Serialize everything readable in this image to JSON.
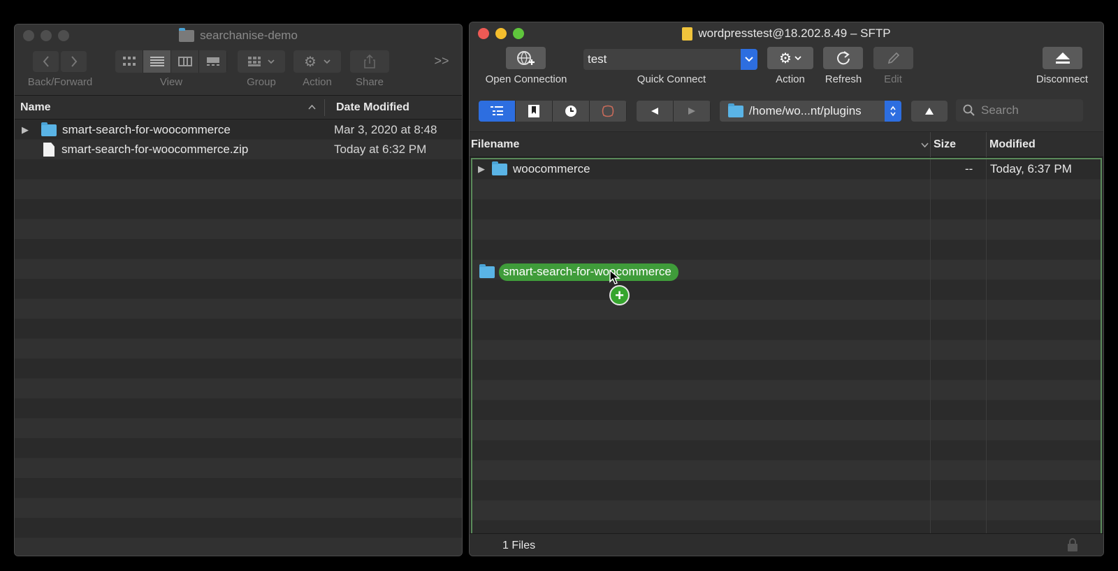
{
  "finder": {
    "title": "searchanise-demo",
    "toolbar": {
      "back_forward_label": "Back/Forward",
      "view_label": "View",
      "group_label": "Group",
      "action_label": "Action",
      "share_label": "Share",
      "more_label": ">>"
    },
    "columns": {
      "name": "Name",
      "date_modified": "Date Modified"
    },
    "rows": [
      {
        "name": "smart-search-for-woocommerce",
        "date": "Mar 3, 2020 at 8:48",
        "kind": "folder"
      },
      {
        "name": "smart-search-for-woocommerce.zip",
        "date": "Today at 6:32 PM",
        "kind": "file"
      }
    ]
  },
  "sftp": {
    "title": "wordpresstest@18.202.8.49 – SFTP",
    "toolbar": {
      "open_connection_label": "Open Connection",
      "quick_connect_value": "test",
      "quick_connect_label": "Quick Connect",
      "action_label": "Action",
      "refresh_label": "Refresh",
      "edit_label": "Edit",
      "disconnect_label": "Disconnect"
    },
    "path": "/home/wo...nt/plugins",
    "search_placeholder": "Search",
    "columns": {
      "filename": "Filename",
      "size": "Size",
      "modified": "Modified"
    },
    "rows": [
      {
        "name": "woocommerce",
        "size": "--",
        "modified": "Today, 6:37 PM"
      }
    ],
    "drag_item": "smart-search-for-woocommerce",
    "status": "1 Files"
  },
  "colors": {
    "accent_blue": "#2d6ee0",
    "drop_green": "#3f9c3a",
    "folder_blue": "#5ab4e6"
  }
}
